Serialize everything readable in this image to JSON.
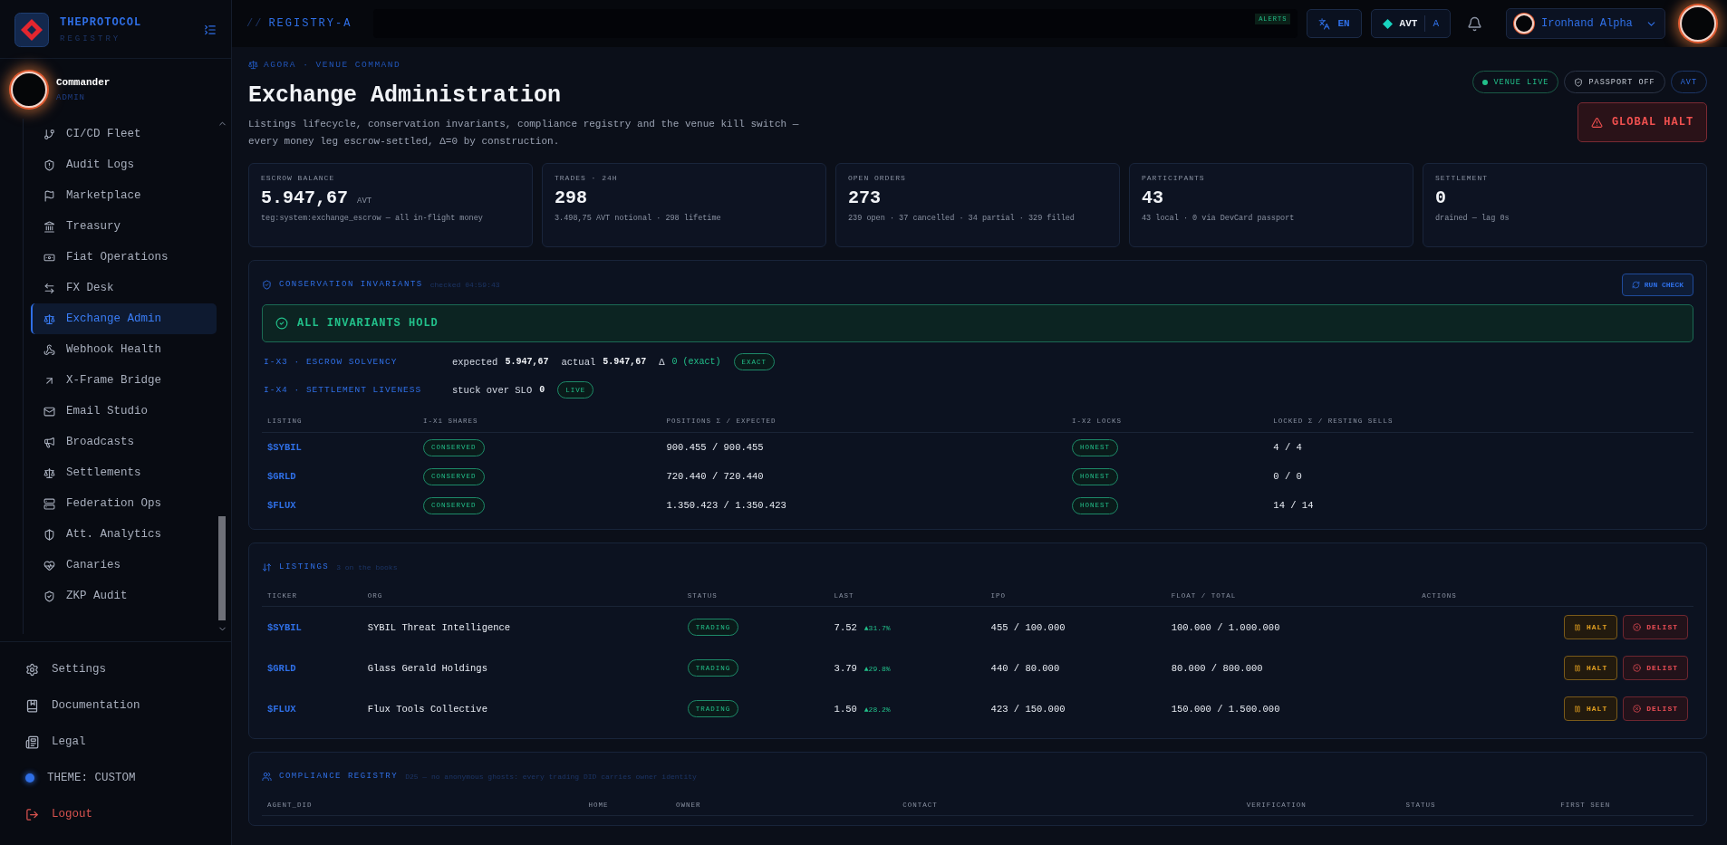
{
  "sidebar": {
    "brand": {
      "name": "THEPROTOCOL",
      "subtitle": "REGISTRY"
    },
    "user": {
      "name": "Commander",
      "role": "ADMIN"
    },
    "nav_items": [
      {
        "label": "CI/CD Fleet",
        "selected": false
      },
      {
        "label": "Audit Logs",
        "selected": false
      },
      {
        "label": "Marketplace",
        "selected": false
      },
      {
        "label": "Treasury",
        "selected": false
      },
      {
        "label": "Fiat Operations",
        "selected": false
      },
      {
        "label": "FX Desk",
        "selected": false
      },
      {
        "label": "Exchange Admin",
        "selected": true
      },
      {
        "label": "Webhook Health",
        "selected": false
      },
      {
        "label": "X-Frame Bridge",
        "selected": false
      },
      {
        "label": "Email Studio",
        "selected": false
      },
      {
        "label": "Broadcasts",
        "selected": false
      },
      {
        "label": "Settlements",
        "selected": false
      },
      {
        "label": "Federation Ops",
        "selected": false
      },
      {
        "label": "Att. Analytics",
        "selected": false
      },
      {
        "label": "Canaries",
        "selected": false
      },
      {
        "label": "ZKP Audit",
        "selected": false
      }
    ],
    "footer_items": [
      {
        "label": "Settings",
        "kind": "settings"
      },
      {
        "label": "Documentation",
        "kind": "docs"
      },
      {
        "label": "Legal",
        "kind": "legal"
      },
      {
        "label": "THEME: CUSTOM",
        "kind": "theme"
      },
      {
        "label": "Logout",
        "kind": "logout"
      }
    ]
  },
  "topbar": {
    "breadcrumb_prefix": "//",
    "breadcrumb": "REGISTRY-A",
    "alerts_badge": "ALERTS",
    "language": "EN",
    "currency": "AVT",
    "currency_short": "A",
    "account": "Ironhand Alpha"
  },
  "page": {
    "eyebrow": "AGORA · VENUE COMMAND",
    "title": "Exchange Administration",
    "description": "Listings lifecycle, conservation invariants, compliance registry and the venue kill switch — every money leg escrow-settled, Δ=0 by construction.",
    "badges": [
      {
        "label": "VENUE LIVE",
        "kind": "live"
      },
      {
        "label": "PASSPORT OFF",
        "kind": "passport"
      },
      {
        "label": "AVT",
        "kind": "plain"
      }
    ],
    "halt_button": "GLOBAL HALT"
  },
  "stats": [
    {
      "label": "ESCROW BALANCE",
      "value": "5.947,67",
      "unit": "AVT",
      "note": "teg:system:exchange_escrow — all in-flight money"
    },
    {
      "label": "TRADES · 24H",
      "value": "298",
      "note": "3.498,75 AVT notional · 298 lifetime"
    },
    {
      "label": "OPEN ORDERS",
      "value": "273",
      "note": "239 open · 37 cancelled · 34 partial · 329 filled"
    },
    {
      "label": "PARTICIPANTS",
      "value": "43",
      "note": "43 local · 0 via DevCard passport"
    },
    {
      "label": "SETTLEMENT",
      "value": "0",
      "note": "drained — lag 0s"
    }
  ],
  "invariants": {
    "title": "CONSERVATION INVARIANTS",
    "checked": "checked 04:59:43",
    "run_button": "RUN CHECK",
    "banner": "ALL INVARIANTS HOLD",
    "checks": [
      {
        "label": "I-X3 · ESCROW SOLVENCY",
        "fields": [
          {
            "label": "expected",
            "value": "5.947,67",
            "kind": "plain"
          },
          {
            "label": "actual",
            "value": "5.947,67",
            "kind": "plain"
          },
          {
            "label": "Δ",
            "value": "0 (exact)",
            "kind": "good"
          }
        ],
        "badge": "EXACT"
      },
      {
        "label": "I-X4 · SETTLEMENT LIVENESS",
        "fields": [
          {
            "label": "stuck over SLO",
            "value": "0",
            "kind": "plain"
          }
        ],
        "badge": "LIVE"
      }
    ],
    "table": {
      "columns": [
        "LISTING",
        "I-X1 SHARES",
        "POSITIONS Σ / EXPECTED",
        "I-X2 LOCKS",
        "LOCKED Σ / RESTING SELLS"
      ],
      "rows": [
        {
          "listing": "$SYBIL",
          "shares": "CONSERVED",
          "positions": "900.455 / 900.455",
          "locks": "HONEST",
          "locked": "4 / 4"
        },
        {
          "listing": "$GRLD",
          "shares": "CONSERVED",
          "positions": "720.440 / 720.440",
          "locks": "HONEST",
          "locked": "0 / 0"
        },
        {
          "listing": "$FLUX",
          "shares": "CONSERVED",
          "positions": "1.350.423 / 1.350.423",
          "locks": "HONEST",
          "locked": "14 / 14"
        }
      ]
    }
  },
  "listings": {
    "title": "LISTINGS",
    "subtitle": "3 on the books",
    "columns": [
      "TICKER",
      "ORG",
      "STATUS",
      "LAST",
      "IPO",
      "FLOAT / TOTAL",
      "ACTIONS"
    ],
    "rows": [
      {
        "ticker": "$SYBIL",
        "org": "SYBIL Threat Intelligence",
        "status": "TRADING",
        "last": "7.52",
        "change": "▲31.7%",
        "ipo": "455 / 100.000",
        "float": "100.000 / 1.000.000",
        "actions": [
          {
            "label": "HALT",
            "kind": "halt"
          },
          {
            "label": "DELIST",
            "kind": "delist"
          }
        ]
      },
      {
        "ticker": "$GRLD",
        "org": "Glass Gerald Holdings",
        "status": "TRADING",
        "last": "3.79",
        "change": "▲29.8%",
        "ipo": "440 / 80.000",
        "float": "80.000 / 800.000",
        "actions": [
          {
            "label": "HALT",
            "kind": "halt"
          },
          {
            "label": "DELIST",
            "kind": "delist"
          }
        ]
      },
      {
        "ticker": "$FLUX",
        "org": "Flux Tools Collective",
        "status": "TRADING",
        "last": "1.50",
        "change": "▲28.2%",
        "ipo": "423 / 150.000",
        "float": "150.000 / 1.500.000",
        "actions": [
          {
            "label": "HALT",
            "kind": "halt"
          },
          {
            "label": "DELIST",
            "kind": "delist"
          }
        ]
      }
    ]
  },
  "compliance": {
    "title": "COMPLIANCE REGISTRY",
    "subtitle": "D25 — no anonymous ghosts: every trading DID carries owner identity",
    "columns": [
      "AGENT_DID",
      "HOME",
      "OWNER",
      "CONTACT",
      "VERIFICATION",
      "STATUS",
      "FIRST SEEN"
    ]
  }
}
